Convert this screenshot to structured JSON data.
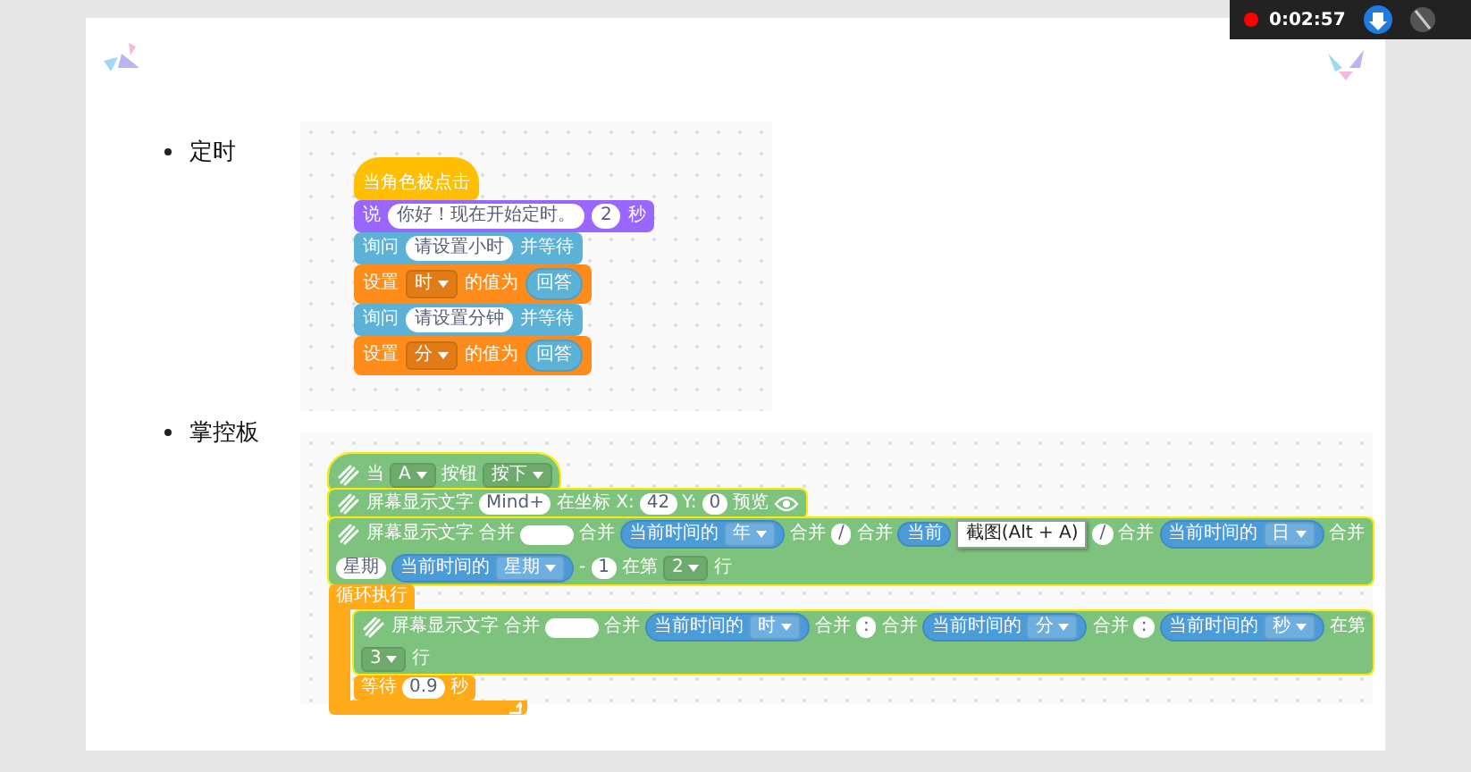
{
  "recorder": {
    "time": "0:02:57"
  },
  "sections": [
    {
      "label": "定时",
      "script": {
        "blocks": [
          {
            "kind": "event",
            "parts": [
              {
                "kind": "label",
                "text": "当角色被点击"
              }
            ]
          },
          {
            "kind": "looks",
            "parts": [
              {
                "kind": "label",
                "text": "说"
              },
              {
                "kind": "input",
                "text": "你好！现在开始定时。"
              },
              {
                "kind": "input",
                "text": "2"
              },
              {
                "kind": "label",
                "text": "秒"
              }
            ]
          },
          {
            "kind": "sensing",
            "parts": [
              {
                "kind": "label",
                "text": "询问"
              },
              {
                "kind": "input",
                "text": "请设置小时"
              },
              {
                "kind": "label",
                "text": "并等待"
              }
            ]
          },
          {
            "kind": "data",
            "parts": [
              {
                "kind": "label",
                "text": "设置"
              },
              {
                "kind": "dropdown",
                "text": "时"
              },
              {
                "kind": "label",
                "text": "的值为"
              },
              {
                "kind": "reporter",
                "text": "回答"
              }
            ]
          },
          {
            "kind": "sensing",
            "parts": [
              {
                "kind": "label",
                "text": "询问"
              },
              {
                "kind": "input",
                "text": "请设置分钟"
              },
              {
                "kind": "label",
                "text": "并等待"
              }
            ]
          },
          {
            "kind": "data",
            "parts": [
              {
                "kind": "label",
                "text": "设置"
              },
              {
                "kind": "dropdown",
                "text": "分"
              },
              {
                "kind": "label",
                "text": "的值为"
              },
              {
                "kind": "reporter",
                "text": "回答"
              }
            ]
          }
        ]
      }
    },
    {
      "label": "掌控板",
      "script": {
        "blocks": [
          {
            "kind": "hat",
            "icon": true,
            "parts": [
              {
                "kind": "label",
                "text": "当"
              },
              {
                "kind": "dropdown",
                "text": "A"
              },
              {
                "kind": "label",
                "text": "按钮"
              },
              {
                "kind": "dropdown",
                "text": "按下"
              }
            ]
          },
          {
            "kind": "stack",
            "icon": true,
            "parts": [
              {
                "kind": "label",
                "text": "屏幕显示文字"
              },
              {
                "kind": "input",
                "text": "Mind+"
              },
              {
                "kind": "label",
                "text": "在坐标 X:"
              },
              {
                "kind": "input",
                "text": "42"
              },
              {
                "kind": "label",
                "text": "Y:"
              },
              {
                "kind": "input",
                "text": "0"
              },
              {
                "kind": "label",
                "text": "预览"
              },
              {
                "kind": "eye"
              }
            ]
          },
          {
            "kind": "stack",
            "icon": true,
            "parts": [
              {
                "kind": "label",
                "text": "屏幕显示文字"
              },
              {
                "kind": "label",
                "text": "合并"
              },
              {
                "kind": "blank"
              },
              {
                "kind": "label",
                "text": "合并"
              },
              {
                "kind": "reporter",
                "text": "当前时间的",
                "option": "年"
              },
              {
                "kind": "label",
                "text": "合并"
              },
              {
                "kind": "input",
                "text": "/"
              },
              {
                "kind": "label",
                "text": "合并"
              },
              {
                "kind": "reporter",
                "text": "当前"
              },
              {
                "kind": "tooltip",
                "text": "截图(Alt + A)"
              },
              {
                "kind": "input",
                "text": "/"
              },
              {
                "kind": "label",
                "text": "合并"
              },
              {
                "kind": "reporter",
                "text": "当前时间的",
                "option": "日"
              },
              {
                "kind": "label",
                "text": "合并"
              },
              {
                "kind": "input",
                "text": "星期"
              },
              {
                "kind": "reporter",
                "text": "当前时间的",
                "option": "星期"
              },
              {
                "kind": "label",
                "text": "-"
              },
              {
                "kind": "input",
                "text": "1"
              },
              {
                "kind": "label",
                "text": "在第"
              },
              {
                "kind": "dropdown",
                "text": "2"
              },
              {
                "kind": "label",
                "text": "行"
              }
            ]
          },
          {
            "kind": "loop",
            "label": "循环执行",
            "body": [
              {
                "kind": "stack",
                "icon": true,
                "parts": [
                  {
                    "kind": "label",
                    "text": "屏幕显示文字"
                  },
                  {
                    "kind": "label",
                    "text": "合并"
                  },
                  {
                    "kind": "blank"
                  },
                  {
                    "kind": "label",
                    "text": "合并"
                  },
                  {
                    "kind": "reporter",
                    "text": "当前时间的",
                    "option": "时"
                  },
                  {
                    "kind": "label",
                    "text": "合并"
                  },
                  {
                    "kind": "input",
                    "text": ":"
                  },
                  {
                    "kind": "label",
                    "text": "合并"
                  },
                  {
                    "kind": "reporter",
                    "text": "当前时间的",
                    "option": "分"
                  },
                  {
                    "kind": "label",
                    "text": "合并"
                  },
                  {
                    "kind": "input",
                    "text": ":"
                  },
                  {
                    "kind": "reporter",
                    "text": "当前时间的",
                    "option": "秒"
                  },
                  {
                    "kind": "label",
                    "text": "在第"
                  },
                  {
                    "kind": "dropdown",
                    "text": "3"
                  },
                  {
                    "kind": "label",
                    "text": "行"
                  }
                ]
              },
              {
                "kind": "wait",
                "parts": [
                  {
                    "kind": "label",
                    "text": "等待"
                  },
                  {
                    "kind": "input",
                    "text": "0.9"
                  },
                  {
                    "kind": "label",
                    "text": "秒"
                  }
                ]
              }
            ]
          }
        ]
      }
    }
  ]
}
